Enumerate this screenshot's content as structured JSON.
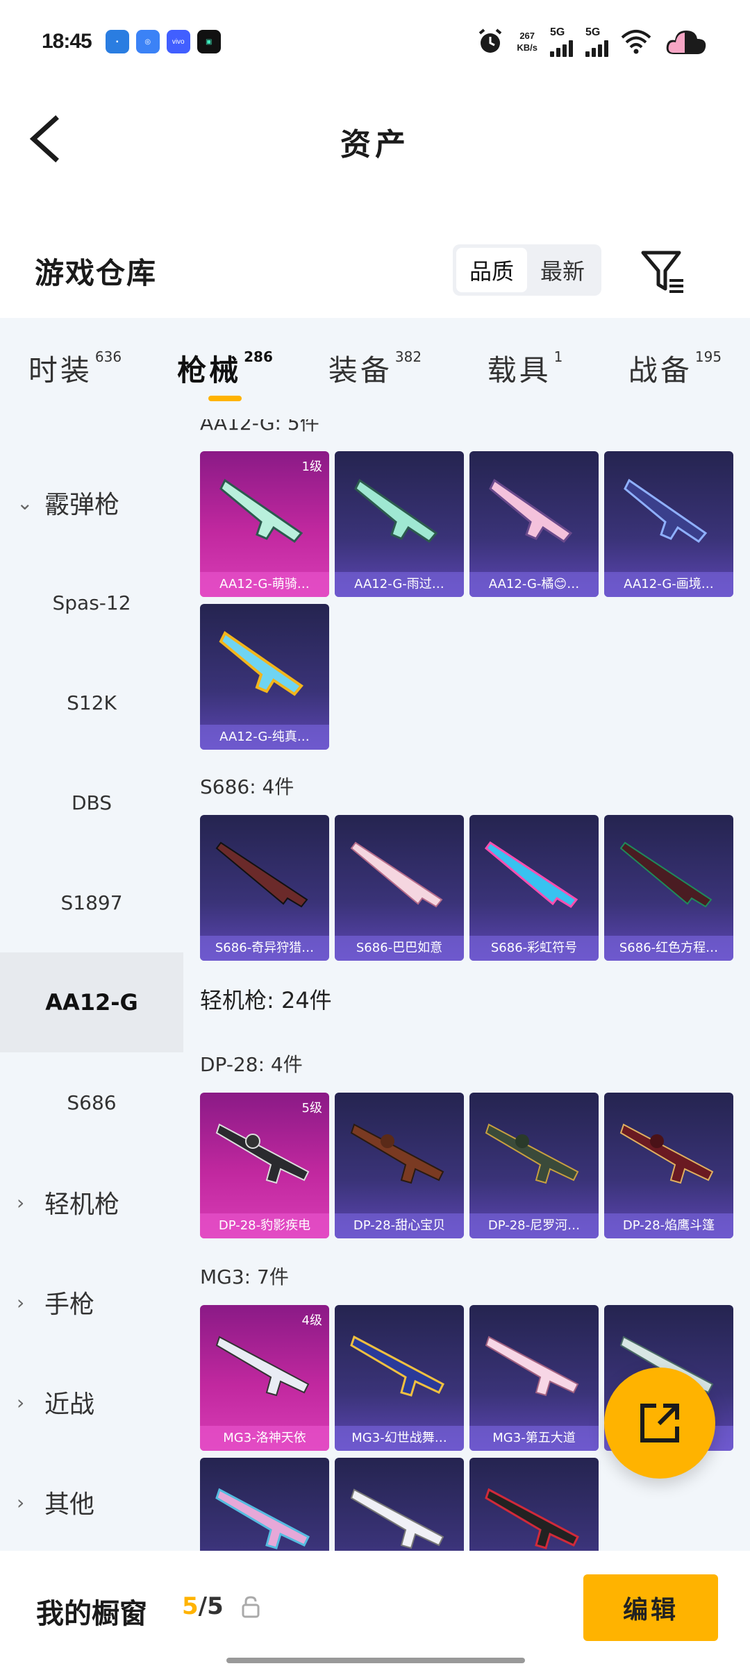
{
  "status_bar": {
    "time": "18:45",
    "net_speed": "267",
    "net_unit": "KB/s",
    "sig1": "5G",
    "sig2": "5G"
  },
  "nav": {
    "title": "资产"
  },
  "header": {
    "title": "游戏仓库",
    "sort_options": [
      "品质",
      "最新"
    ],
    "active_sort": "品质"
  },
  "tabs": [
    {
      "label": "时装",
      "count": "636"
    },
    {
      "label": "枪械",
      "count": "286"
    },
    {
      "label": "装备",
      "count": "382"
    },
    {
      "label": "载具",
      "count": "1"
    },
    {
      "label": "战备",
      "count": "195"
    }
  ],
  "active_tab": "枪械",
  "sidebar": {
    "items": [
      {
        "label": "霰弹枪",
        "type": "category",
        "expanded": true
      },
      {
        "label": "Spas-12",
        "type": "sub"
      },
      {
        "label": "S12K",
        "type": "sub"
      },
      {
        "label": "DBS",
        "type": "sub"
      },
      {
        "label": "S1897",
        "type": "sub"
      },
      {
        "label": "AA12-G",
        "type": "sub",
        "active": true
      },
      {
        "label": "S686",
        "type": "sub"
      },
      {
        "label": "轻机枪",
        "type": "category"
      },
      {
        "label": "手枪",
        "type": "category"
      },
      {
        "label": "近战",
        "type": "category"
      },
      {
        "label": "其他",
        "type": "category"
      }
    ]
  },
  "content": {
    "groups": [
      {
        "label": "AA12-G: 5件",
        "items": [
          {
            "name": "AA12-G-萌骑…",
            "level": "1级",
            "featured": true
          },
          {
            "name": "AA12-G-雨过…"
          },
          {
            "name": "AA12-G-橘😊…"
          },
          {
            "name": "AA12-G-画境…"
          },
          {
            "name": "AA12-G-纯真…"
          }
        ]
      },
      {
        "label": "S686: 4件",
        "items": [
          {
            "name": "S686-奇异狩猎…"
          },
          {
            "name": "S686-巴巴如意"
          },
          {
            "name": "S686-彩虹符号"
          },
          {
            "name": "S686-红色方程…"
          }
        ]
      },
      {
        "label": "轻机枪: 24件",
        "heading": true
      },
      {
        "label": "DP-28: 4件",
        "items": [
          {
            "name": "DP-28-豹影疾电",
            "level": "5级",
            "featured": true
          },
          {
            "name": "DP-28-甜心宝贝"
          },
          {
            "name": "DP-28-尼罗河…"
          },
          {
            "name": "DP-28-焰鹰斗篷"
          }
        ]
      },
      {
        "label": "MG3: 7件",
        "items": [
          {
            "name": "MG3-洛神天依",
            "level": "4级",
            "featured": true
          },
          {
            "name": "MG3-幻世战舞…"
          },
          {
            "name": "MG3-第五大道"
          },
          {
            "name": ""
          },
          {
            "name": ""
          },
          {
            "name": ""
          },
          {
            "name": ""
          }
        ]
      }
    ]
  },
  "bottom_bar": {
    "label": "我的橱窗",
    "current": "5",
    "total": "/5",
    "edit_label": "编辑"
  },
  "colors": {
    "accent": "#ffb300",
    "card_dark": "#2b2a5c",
    "card_featured": "#c1289f",
    "panel_bg": "#f2f6fa"
  }
}
